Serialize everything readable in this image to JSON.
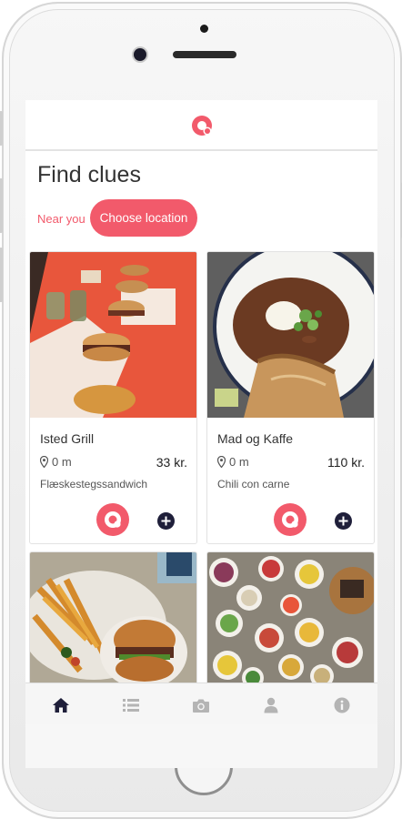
{
  "app": {
    "logo_icon": "q-logo-icon",
    "accent_color": "#f25a6b",
    "dark_color": "#1f1f3a"
  },
  "page": {
    "title": "Find clues",
    "near_you_label": "Near you",
    "choose_location_label": "Choose location"
  },
  "cards": [
    {
      "name": "Isted Grill",
      "distance": "0 m",
      "price": "33 kr.",
      "dish": "Flæskestegssandwich"
    },
    {
      "name": "Mad og Kaffe",
      "distance": "0 m",
      "price": "110 kr.",
      "dish": "Chili con carne"
    },
    {
      "name": "",
      "distance": "",
      "price": "",
      "dish": ""
    },
    {
      "name": "",
      "distance": "",
      "price": "",
      "dish": ""
    }
  ],
  "bottom_nav": [
    {
      "icon": "home-icon",
      "active": true
    },
    {
      "icon": "list-icon",
      "active": false
    },
    {
      "icon": "camera-icon",
      "active": false
    },
    {
      "icon": "user-icon",
      "active": false
    },
    {
      "icon": "info-icon",
      "active": false
    }
  ]
}
